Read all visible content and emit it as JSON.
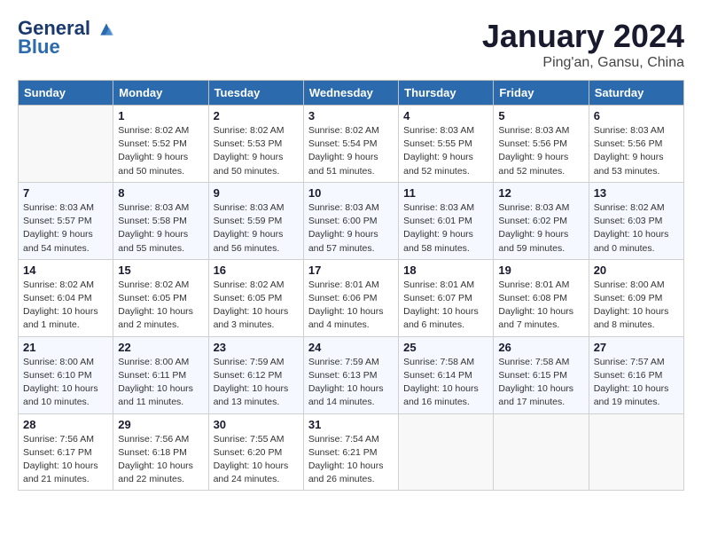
{
  "header": {
    "logo_line1": "General",
    "logo_line2": "Blue",
    "month": "January 2024",
    "location": "Ping'an, Gansu, China"
  },
  "days_of_week": [
    "Sunday",
    "Monday",
    "Tuesday",
    "Wednesday",
    "Thursday",
    "Friday",
    "Saturday"
  ],
  "weeks": [
    [
      {
        "day": "",
        "sunrise": "",
        "sunset": "",
        "daylight": ""
      },
      {
        "day": "1",
        "sunrise": "Sunrise: 8:02 AM",
        "sunset": "Sunset: 5:52 PM",
        "daylight": "Daylight: 9 hours and 50 minutes."
      },
      {
        "day": "2",
        "sunrise": "Sunrise: 8:02 AM",
        "sunset": "Sunset: 5:53 PM",
        "daylight": "Daylight: 9 hours and 50 minutes."
      },
      {
        "day": "3",
        "sunrise": "Sunrise: 8:02 AM",
        "sunset": "Sunset: 5:54 PM",
        "daylight": "Daylight: 9 hours and 51 minutes."
      },
      {
        "day": "4",
        "sunrise": "Sunrise: 8:03 AM",
        "sunset": "Sunset: 5:55 PM",
        "daylight": "Daylight: 9 hours and 52 minutes."
      },
      {
        "day": "5",
        "sunrise": "Sunrise: 8:03 AM",
        "sunset": "Sunset: 5:56 PM",
        "daylight": "Daylight: 9 hours and 52 minutes."
      },
      {
        "day": "6",
        "sunrise": "Sunrise: 8:03 AM",
        "sunset": "Sunset: 5:56 PM",
        "daylight": "Daylight: 9 hours and 53 minutes."
      }
    ],
    [
      {
        "day": "7",
        "sunrise": "Sunrise: 8:03 AM",
        "sunset": "Sunset: 5:57 PM",
        "daylight": "Daylight: 9 hours and 54 minutes."
      },
      {
        "day": "8",
        "sunrise": "Sunrise: 8:03 AM",
        "sunset": "Sunset: 5:58 PM",
        "daylight": "Daylight: 9 hours and 55 minutes."
      },
      {
        "day": "9",
        "sunrise": "Sunrise: 8:03 AM",
        "sunset": "Sunset: 5:59 PM",
        "daylight": "Daylight: 9 hours and 56 minutes."
      },
      {
        "day": "10",
        "sunrise": "Sunrise: 8:03 AM",
        "sunset": "Sunset: 6:00 PM",
        "daylight": "Daylight: 9 hours and 57 minutes."
      },
      {
        "day": "11",
        "sunrise": "Sunrise: 8:03 AM",
        "sunset": "Sunset: 6:01 PM",
        "daylight": "Daylight: 9 hours and 58 minutes."
      },
      {
        "day": "12",
        "sunrise": "Sunrise: 8:03 AM",
        "sunset": "Sunset: 6:02 PM",
        "daylight": "Daylight: 9 hours and 59 minutes."
      },
      {
        "day": "13",
        "sunrise": "Sunrise: 8:02 AM",
        "sunset": "Sunset: 6:03 PM",
        "daylight": "Daylight: 10 hours and 0 minutes."
      }
    ],
    [
      {
        "day": "14",
        "sunrise": "Sunrise: 8:02 AM",
        "sunset": "Sunset: 6:04 PM",
        "daylight": "Daylight: 10 hours and 1 minute."
      },
      {
        "day": "15",
        "sunrise": "Sunrise: 8:02 AM",
        "sunset": "Sunset: 6:05 PM",
        "daylight": "Daylight: 10 hours and 2 minutes."
      },
      {
        "day": "16",
        "sunrise": "Sunrise: 8:02 AM",
        "sunset": "Sunset: 6:05 PM",
        "daylight": "Daylight: 10 hours and 3 minutes."
      },
      {
        "day": "17",
        "sunrise": "Sunrise: 8:01 AM",
        "sunset": "Sunset: 6:06 PM",
        "daylight": "Daylight: 10 hours and 4 minutes."
      },
      {
        "day": "18",
        "sunrise": "Sunrise: 8:01 AM",
        "sunset": "Sunset: 6:07 PM",
        "daylight": "Daylight: 10 hours and 6 minutes."
      },
      {
        "day": "19",
        "sunrise": "Sunrise: 8:01 AM",
        "sunset": "Sunset: 6:08 PM",
        "daylight": "Daylight: 10 hours and 7 minutes."
      },
      {
        "day": "20",
        "sunrise": "Sunrise: 8:00 AM",
        "sunset": "Sunset: 6:09 PM",
        "daylight": "Daylight: 10 hours and 8 minutes."
      }
    ],
    [
      {
        "day": "21",
        "sunrise": "Sunrise: 8:00 AM",
        "sunset": "Sunset: 6:10 PM",
        "daylight": "Daylight: 10 hours and 10 minutes."
      },
      {
        "day": "22",
        "sunrise": "Sunrise: 8:00 AM",
        "sunset": "Sunset: 6:11 PM",
        "daylight": "Daylight: 10 hours and 11 minutes."
      },
      {
        "day": "23",
        "sunrise": "Sunrise: 7:59 AM",
        "sunset": "Sunset: 6:12 PM",
        "daylight": "Daylight: 10 hours and 13 minutes."
      },
      {
        "day": "24",
        "sunrise": "Sunrise: 7:59 AM",
        "sunset": "Sunset: 6:13 PM",
        "daylight": "Daylight: 10 hours and 14 minutes."
      },
      {
        "day": "25",
        "sunrise": "Sunrise: 7:58 AM",
        "sunset": "Sunset: 6:14 PM",
        "daylight": "Daylight: 10 hours and 16 minutes."
      },
      {
        "day": "26",
        "sunrise": "Sunrise: 7:58 AM",
        "sunset": "Sunset: 6:15 PM",
        "daylight": "Daylight: 10 hours and 17 minutes."
      },
      {
        "day": "27",
        "sunrise": "Sunrise: 7:57 AM",
        "sunset": "Sunset: 6:16 PM",
        "daylight": "Daylight: 10 hours and 19 minutes."
      }
    ],
    [
      {
        "day": "28",
        "sunrise": "Sunrise: 7:56 AM",
        "sunset": "Sunset: 6:17 PM",
        "daylight": "Daylight: 10 hours and 21 minutes."
      },
      {
        "day": "29",
        "sunrise": "Sunrise: 7:56 AM",
        "sunset": "Sunset: 6:18 PM",
        "daylight": "Daylight: 10 hours and 22 minutes."
      },
      {
        "day": "30",
        "sunrise": "Sunrise: 7:55 AM",
        "sunset": "Sunset: 6:20 PM",
        "daylight": "Daylight: 10 hours and 24 minutes."
      },
      {
        "day": "31",
        "sunrise": "Sunrise: 7:54 AM",
        "sunset": "Sunset: 6:21 PM",
        "daylight": "Daylight: 10 hours and 26 minutes."
      },
      {
        "day": "",
        "sunrise": "",
        "sunset": "",
        "daylight": ""
      },
      {
        "day": "",
        "sunrise": "",
        "sunset": "",
        "daylight": ""
      },
      {
        "day": "",
        "sunrise": "",
        "sunset": "",
        "daylight": ""
      }
    ]
  ]
}
